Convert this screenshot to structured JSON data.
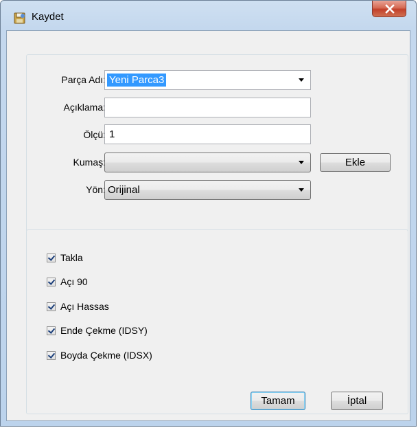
{
  "window": {
    "title": "Kaydet",
    "icon": "save-disk-icon"
  },
  "form": {
    "parca_adi": {
      "label": "Parça Adı:",
      "value": "Yeni Parca3"
    },
    "aciklama": {
      "label": "Açıklama:",
      "value": ""
    },
    "olcu": {
      "label": "Ölçü:",
      "value": "1"
    },
    "kumas": {
      "label": "Kumaş:",
      "value": "",
      "add_button": "Ekle"
    },
    "yon": {
      "label": "Yön:",
      "value": "Orijinal"
    }
  },
  "options": [
    {
      "label": "Takla",
      "checked": true
    },
    {
      "label": "Açı 90",
      "checked": true
    },
    {
      "label": "Açı Hassas",
      "checked": true
    },
    {
      "label": "Ende Çekme (IDSY)",
      "checked": true
    },
    {
      "label": "Boyda Çekme (IDSX)",
      "checked": true
    }
  ],
  "buttons": {
    "ok": "Tamam",
    "cancel": "İptal"
  }
}
